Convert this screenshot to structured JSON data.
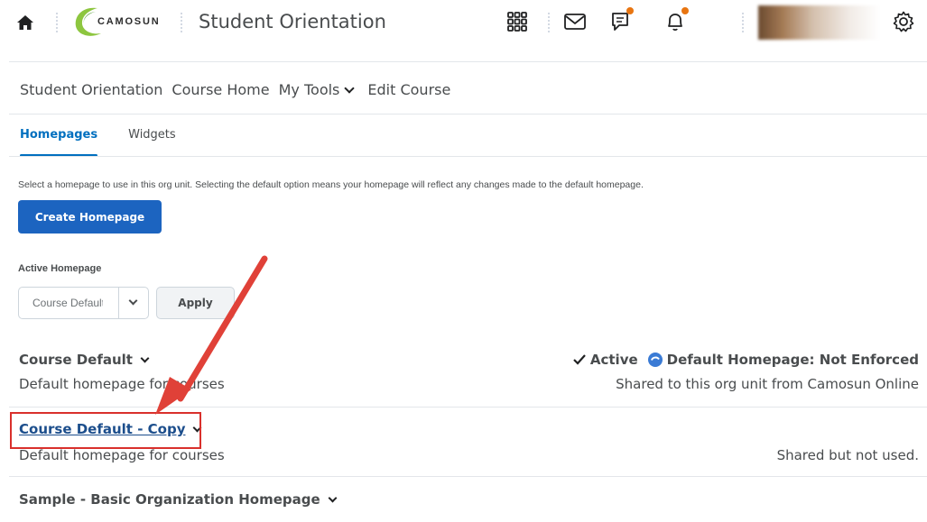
{
  "header": {
    "logo_text": "CAMOSUN",
    "course_title": "Student Orientation",
    "icons": [
      "home-icon",
      "grid-icon",
      "mail-icon",
      "chat-icon",
      "bell-icon",
      "gear-icon"
    ],
    "accent_color": "#e87511"
  },
  "navbar": {
    "items": [
      "Student Orientation",
      "Course Home",
      "My Tools",
      "Edit Course"
    ]
  },
  "tabs": {
    "active": "Homepages",
    "other": "Widgets"
  },
  "page": {
    "description": "Select a homepage to use in this org unit. Selecting the default option means your homepage will reflect any changes made to the default homepage.",
    "create_button": "Create Homepage",
    "active_label": "Active Homepage",
    "select_value": "Course Default",
    "apply_button": "Apply",
    "primary_color": "#1c64c0"
  },
  "homepages": [
    {
      "title": "Course Default",
      "subtitle": "Default homepage for courses",
      "status_active": "Active",
      "status_default": "Default Homepage: Not Enforced",
      "shared": "Shared to this org unit from Camosun Online"
    },
    {
      "title": "Course Default - Copy",
      "subtitle": "Default homepage for courses",
      "shared": "Shared but not used."
    },
    {
      "title": "Sample - Basic Organization Homepage"
    }
  ]
}
